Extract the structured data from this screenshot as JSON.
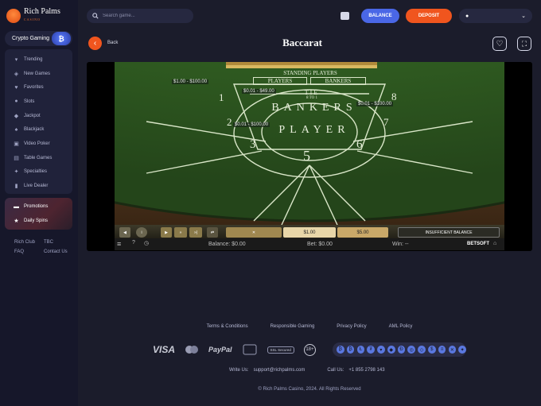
{
  "brand": {
    "name": "Rich Palms",
    "tagline": "CASINO"
  },
  "crypto_banner": {
    "label": "Crypto Gaming",
    "coin": "₿"
  },
  "nav": {
    "items": [
      {
        "label": "Trending",
        "icon": "trending-icon"
      },
      {
        "label": "New Games",
        "icon": "new-games-icon"
      },
      {
        "label": "Favorites",
        "icon": "heart-icon"
      },
      {
        "label": "Slots",
        "icon": "slots-icon"
      },
      {
        "label": "Jackpot",
        "icon": "jackpot-icon"
      },
      {
        "label": "Blackjack",
        "icon": "cards-icon"
      },
      {
        "label": "Video Poker",
        "icon": "video-poker-icon"
      },
      {
        "label": "Table Games",
        "icon": "table-games-icon"
      },
      {
        "label": "Specialties",
        "icon": "specialties-icon"
      },
      {
        "label": "Live Dealer",
        "icon": "live-dealer-icon"
      }
    ]
  },
  "promo": {
    "promotions": "Promotions",
    "daily_spins": "Daily Spins"
  },
  "sidebar_footer": {
    "rich_club": "Rich Club",
    "tbc": "TBC",
    "faq": "FAQ",
    "contact_us": "Contact Us"
  },
  "search": {
    "placeholder": "Search game..."
  },
  "topbar": {
    "balance": "BALANCE",
    "deposit": "DEPOSIT"
  },
  "game": {
    "back": "Back",
    "title": "Baccarat"
  },
  "table": {
    "standing_players": "STANDING PLAYERS",
    "players": "PLAYERS",
    "bankers": "BANKERS",
    "tie": "TIE",
    "tie_payout": "8 TO 1",
    "banker_word": "BANKERS",
    "player_word": "PLAYER",
    "seat_numbers": [
      "1",
      "2",
      "3",
      "5",
      "6",
      "7",
      "8"
    ],
    "limits": {
      "top_left": "$1.00 - $100.00",
      "tie": "$0.01 - $49.00",
      "right": "$0.01 - $100.00",
      "left": "$0.01 - $100.00"
    }
  },
  "controls": {
    "chip_value": "$1.00",
    "bet_value": "$5.00",
    "insufficient": "INSUFFICIENT BALANCE"
  },
  "status": {
    "balance": "Balance: $0.00",
    "bet": "Bet: $0.00",
    "win": "Win: --",
    "provider": "BETSOFT"
  },
  "footer": {
    "links": [
      "Terms & Conditions",
      "Responsible Gaming",
      "Privacy Policy",
      "AML Policy"
    ],
    "visa": "VISA",
    "paypal": "PayPal",
    "ssl": "SSL Secured",
    "age": "18+",
    "write_us_label": "Write Us:",
    "email": "support@richpalms.com",
    "call_us_label": "Call Us:",
    "phone": "+1 855 2798 143",
    "copyright": "© Rich Palms Casino, 2024. All Rights Reserved"
  },
  "colors": {
    "accent": "#f0551e",
    "balance": "#4a67e6",
    "felt": "#2f5a1f"
  }
}
